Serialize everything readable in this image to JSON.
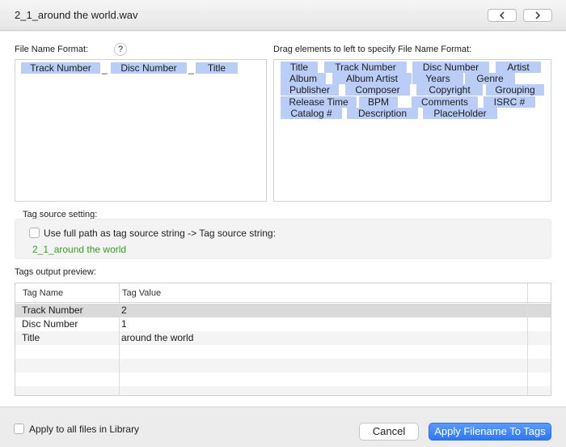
{
  "window": {
    "title": "2_1_around the world.wav",
    "back_icon": "chevron-left-icon",
    "forward_icon": "chevron-right-icon"
  },
  "file_name_format": {
    "label": "File Name Format:",
    "help": "?",
    "chips": [
      "Track Number",
      "Disc Number",
      "Title"
    ],
    "separators": [
      "_",
      "_"
    ]
  },
  "elements": {
    "label": "Drag elements to left to specify File Name Format:",
    "rows": [
      [
        "Title",
        "Track Number",
        "Disc Number",
        "Artist"
      ],
      [
        "Album",
        "Album Artist",
        "Years",
        "Genre"
      ],
      [
        "Publisher",
        "Composer",
        "Copyright",
        "Grouping"
      ],
      [
        "Release Time",
        "BPM",
        "Comments",
        "ISRC #"
      ],
      [
        "Catalog #",
        "Description",
        "PlaceHolder"
      ]
    ]
  },
  "tag_source": {
    "label": "Tag source setting:",
    "checkbox_label": "Use full path as tag source string -> Tag source string:",
    "checked": false,
    "source_string": "2_1_around the world",
    "source_color": "#3a9a25"
  },
  "preview": {
    "label": "Tags output preview:",
    "columns": [
      "Tag Name",
      "Tag Value"
    ],
    "rows": [
      {
        "name": "Track Number",
        "value": "2"
      },
      {
        "name": "Disc Number",
        "value": "1"
      },
      {
        "name": "Title",
        "value": "around the world"
      }
    ]
  },
  "footer": {
    "apply_all_label": "Apply to all files in Library",
    "apply_all_checked": false,
    "cancel_label": "Cancel",
    "apply_label": "Apply Filename To Tags",
    "accent": "#2f78f4"
  }
}
